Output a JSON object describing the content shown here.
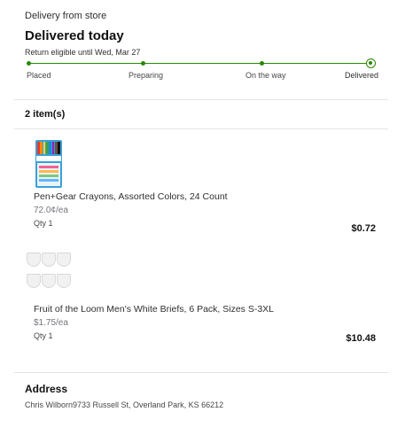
{
  "header": {
    "source": "Delivery from store",
    "title": "Delivered today",
    "return_note": "Return eligible until Wed, Mar 27"
  },
  "tracker": {
    "steps": [
      {
        "label": "Placed"
      },
      {
        "label": "Preparing"
      },
      {
        "label": "On the way"
      },
      {
        "label": "Delivered"
      }
    ],
    "current_step": "Delivered",
    "accent_color": "#2a8703"
  },
  "items_summary": {
    "count_label": "2 item(s)"
  },
  "items": [
    {
      "name": "Pen+Gear Crayons, Assorted Colors, 24 Count",
      "unit_price": "72.0¢/ea",
      "qty": "Qty 1",
      "total": "$0.72",
      "image": "crayons-box"
    },
    {
      "name": "Fruit of the Loom Men's White Briefs, 6 Pack, Sizes S-3XL",
      "unit_price": "$1.75/ea",
      "qty": "Qty 1",
      "total": "$10.48",
      "image": "white-briefs-pack"
    }
  ],
  "address": {
    "title": "Address",
    "line": "Chris Wilborn9733 Russell St, Overland Park, KS 66212"
  }
}
